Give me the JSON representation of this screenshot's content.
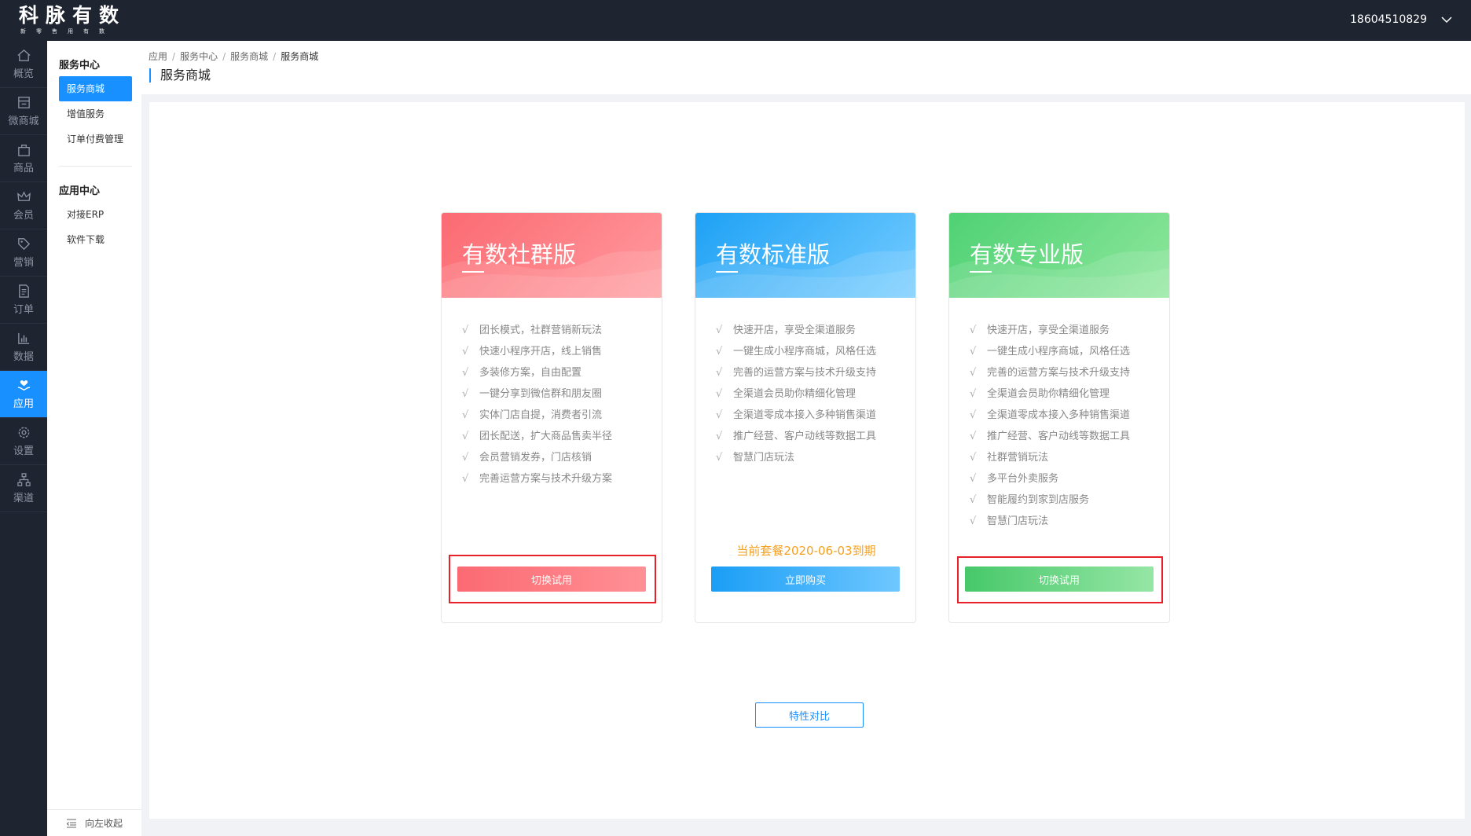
{
  "brand": {
    "name": "科脉有数",
    "tagline": "新零售用有数"
  },
  "user": {
    "phone": "18604510829",
    "chevron_icon": "chevron-down-icon"
  },
  "rail": [
    {
      "label": "概览",
      "icon": "home-icon",
      "active": false
    },
    {
      "label": "微商城",
      "icon": "store-icon",
      "active": false
    },
    {
      "label": "商品",
      "icon": "bag-icon",
      "active": false
    },
    {
      "label": "会员",
      "icon": "crown-icon",
      "active": false
    },
    {
      "label": "营销",
      "icon": "tag-icon",
      "active": false
    },
    {
      "label": "订单",
      "icon": "document-icon",
      "active": false
    },
    {
      "label": "数据",
      "icon": "bar-chart-icon",
      "active": false
    },
    {
      "label": "应用",
      "icon": "heart-hand-icon",
      "active": true
    },
    {
      "label": "设置",
      "icon": "gear-icon",
      "active": false
    },
    {
      "label": "渠道",
      "icon": "network-icon",
      "active": false
    }
  ],
  "subnav": {
    "group1": {
      "title": "服务中心",
      "items": [
        "服务商城",
        "增值服务",
        "订单付费管理"
      ]
    },
    "group2": {
      "title": "应用中心",
      "items": [
        "对接ERP",
        "软件下载"
      ]
    },
    "collapse_label": "向左收起"
  },
  "breadcrumb": [
    "应用",
    "服务中心",
    "服务商城",
    "服务商城"
  ],
  "page_title": "服务商城",
  "plans": [
    {
      "title": "有数社群版",
      "theme": "#fb6a72",
      "features": [
        "团长模式，社群营销新玩法",
        "快速小程序开店，线上销售",
        "多装修方案，自由配置",
        "一键分享到微信群和朋友圈",
        "实体门店自提，消费者引流",
        "团长配送，扩大商品售卖半径",
        "会员营销发券，门店核销",
        "完善运营方案与技术升级方案"
      ],
      "button": "切换试用"
    },
    {
      "title": "有数标准版",
      "theme": "#1ea1f5",
      "features": [
        "快速开店，享受全渠道服务",
        "一键生成小程序商城，风格任选",
        "完善的运营方案与技术升级支持",
        "全渠道会员助你精细化管理",
        "全渠道零成本接入多种销售渠道",
        "推广经营、客户动线等数据工具",
        "智慧门店玩法"
      ],
      "expire": "当前套餐2020-06-03到期",
      "button": "立即购买"
    },
    {
      "title": "有数专业版",
      "theme": "#4fd174",
      "features": [
        "快速开店，享受全渠道服务",
        "一键生成小程序商城，风格任选",
        "完善的运营方案与技术升级支持",
        "全渠道会员助你精细化管理",
        "全渠道零成本接入多种销售渠道",
        "推广经营、客户动线等数据工具",
        "社群营销玩法",
        "多平台外卖服务",
        "智能履约到家到店服务",
        "智慧门店玩法"
      ],
      "button": "切换试用"
    }
  ],
  "check_mark": "√",
  "compare_button": "特性对比"
}
